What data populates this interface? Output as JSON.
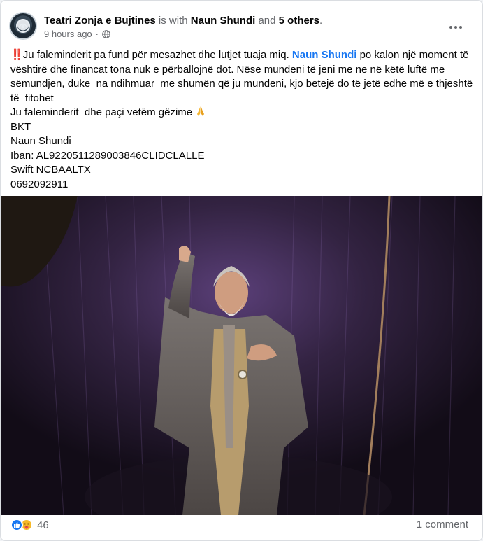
{
  "header": {
    "page_name": "Teatri Zonja e Bujtines",
    "with_text": "is with",
    "tagged_name": "Naun Shundi",
    "and_text": "and",
    "others": "5 others",
    "period": ".",
    "time": "9 hours ago",
    "separator": "·",
    "privacy_icon": "globe-icon",
    "more_icon": "more-options-icon"
  },
  "post": {
    "emoji_start": "‼️",
    "text_1": "Ju faleminderit pa fund për mesazhet dhe lutjet tuaja miq. ",
    "mention": "Naun Shundi",
    "text_2": " po kalon një moment të vështirë dhe financat tona nuk e përballojnë dot. Nëse mundeni të jeni me ne në këtë luftë me sëmundjen, duke  na ndihmuar  me shumën që ju mundeni, kjo betejë do të jetë edhe më e thjeshtë të  fitohet",
    "line_thanks": "Ju faleminderit  dhe paçi vetëm gëzime ",
    "pray_icon": "folded-hands-icon",
    "bank": "BKT",
    "account_name": "Naun Shundi",
    "iban": "Iban: AL9220511289003846CLIDCLALLE",
    "swift": "Swift NCBAALTX",
    "phone": "0692092911"
  },
  "photo": {
    "subject": "actor-on-stage-photo"
  },
  "footer": {
    "reaction_icons": [
      "like-icon",
      "care-icon"
    ],
    "reaction_count": "46",
    "comments": "1 comment"
  },
  "colors": {
    "link": "#1877f2",
    "muted": "#65676b",
    "like": "#1877f2",
    "care": "#f7b928"
  }
}
